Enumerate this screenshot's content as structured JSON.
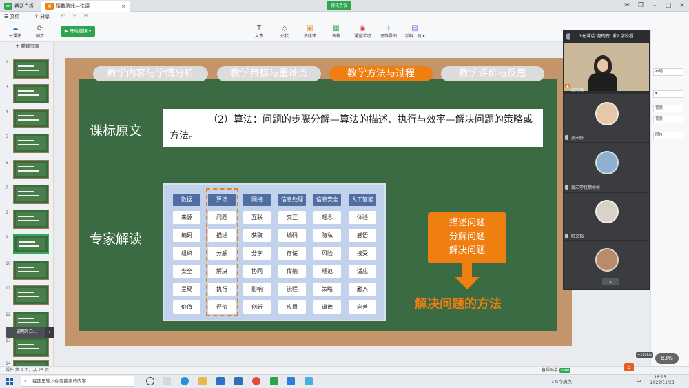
{
  "tabs": {
    "app": "希沃白板",
    "doc": "猜数游戏—洗课"
  },
  "meeting_title_bar": "腾讯会议",
  "toolbar": {
    "file": "文件",
    "share": "分享",
    "cloud": "云课件",
    "sync": "同步",
    "start": "开始授课",
    "tools": [
      "文本",
      "形状",
      "多媒体",
      "表格",
      "课堂活动",
      "思维导图",
      "学科工具"
    ]
  },
  "left": {
    "new_page": "新建页面",
    "thumb_numbers": [
      "2",
      "3",
      "4",
      "5",
      "6",
      "7",
      "8",
      "9",
      "10",
      "11",
      "12",
      "13",
      "14"
    ],
    "selected": "9"
  },
  "slide": {
    "tabs": [
      "教学内容与学情分析",
      "教学目标与重难点",
      "教学方法与过程",
      "教学评价与反思"
    ],
    "active_tab": 2,
    "heading1": "课标原文",
    "heading2": "专家解读",
    "quote": "（2）算法：问题的步骤分解—算法的描述、执行与效率—解决问题的策略或方法。",
    "columns": [
      {
        "head": "数据",
        "cells": [
          "来源",
          "编码",
          "组织",
          "安全",
          "呈现",
          "价值"
        ]
      },
      {
        "head": "算法",
        "cells": [
          "问题",
          "描述",
          "分解",
          "解决",
          "执行",
          "评价"
        ]
      },
      {
        "head": "网络",
        "cells": [
          "互联",
          "获取",
          "分享",
          "协同",
          "影响",
          "创新"
        ]
      },
      {
        "head": "信息处理",
        "cells": [
          "交互",
          "编码",
          "存储",
          "传输",
          "流程",
          "应用"
        ]
      },
      {
        "head": "信息安全",
        "cells": [
          "观念",
          "隐私",
          "风险",
          "规范",
          "策略",
          "道德"
        ]
      },
      {
        "head": "人工智能",
        "cells": [
          "体验",
          "感悟",
          "接受",
          "适应",
          "融入",
          "向善"
        ]
      }
    ],
    "callout": [
      "描述问题",
      "分解问题",
      "解决问题"
    ],
    "method_label": "解决问题的方法"
  },
  "meeting": {
    "speaking": "正在讲话: 赵朗晚; 爱汇学校看...",
    "participants": [
      "赵朗晚",
      "吴天妍",
      "爱汇学校颜彬彬",
      "陆文韬"
    ]
  },
  "right_panel": [
    "布局",
    "背景",
    "背景",
    "图片"
  ],
  "status": {
    "page": "课件 第 9 页，共 25 页",
    "assistant": "备课助手",
    "badge": "new",
    "percent": "83%",
    "speed": "+102k/s"
  },
  "taskbar": {
    "search_placeholder": "在这里输入你要搜索的内容",
    "weather": "14:今热点",
    "time": "16:15",
    "date": "2022/11/23",
    "ime": "中"
  },
  "popup": "调用外白..."
}
